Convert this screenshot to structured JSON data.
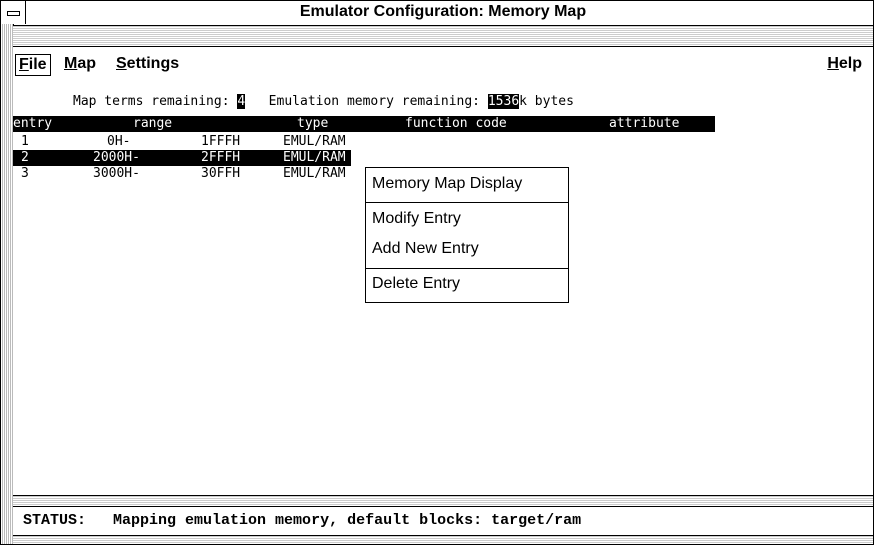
{
  "window": {
    "title": "Emulator Configuration: Memory Map"
  },
  "menubar": {
    "file": {
      "mnemonic": "F",
      "rest": "ile"
    },
    "map": {
      "mnemonic": "M",
      "rest": "ap"
    },
    "settings": {
      "mnemonic": "S",
      "rest": "ettings"
    },
    "help": {
      "mnemonic": "H",
      "rest": "elp"
    }
  },
  "info": {
    "terms_label": "Map terms remaining: ",
    "terms_value": "4",
    "memory_label": "   Emulation memory remaining: ",
    "memory_value": "1536",
    "memory_unit": "k bytes"
  },
  "table": {
    "headers": {
      "entry": "entry",
      "range": "range",
      "type": "type",
      "function_code": "function code",
      "attribute": "attribute"
    },
    "rows": [
      {
        "entry": "1",
        "start": "0H-",
        "end": "1FFFH",
        "type": "EMUL/RAM",
        "selected": false
      },
      {
        "entry": "2",
        "start": "2000H-",
        "end": "2FFFH",
        "type": "EMUL/RAM",
        "selected": true
      },
      {
        "entry": "3",
        "start": "3000H-",
        "end": "30FFH",
        "type": "EMUL/RAM",
        "selected": false
      }
    ]
  },
  "popup": {
    "items": [
      "Memory Map Display",
      "Modify Entry",
      "Add New Entry",
      "Delete Entry"
    ]
  },
  "status": {
    "label": "STATUS:",
    "message": "Mapping emulation memory, default blocks: target/ram"
  }
}
